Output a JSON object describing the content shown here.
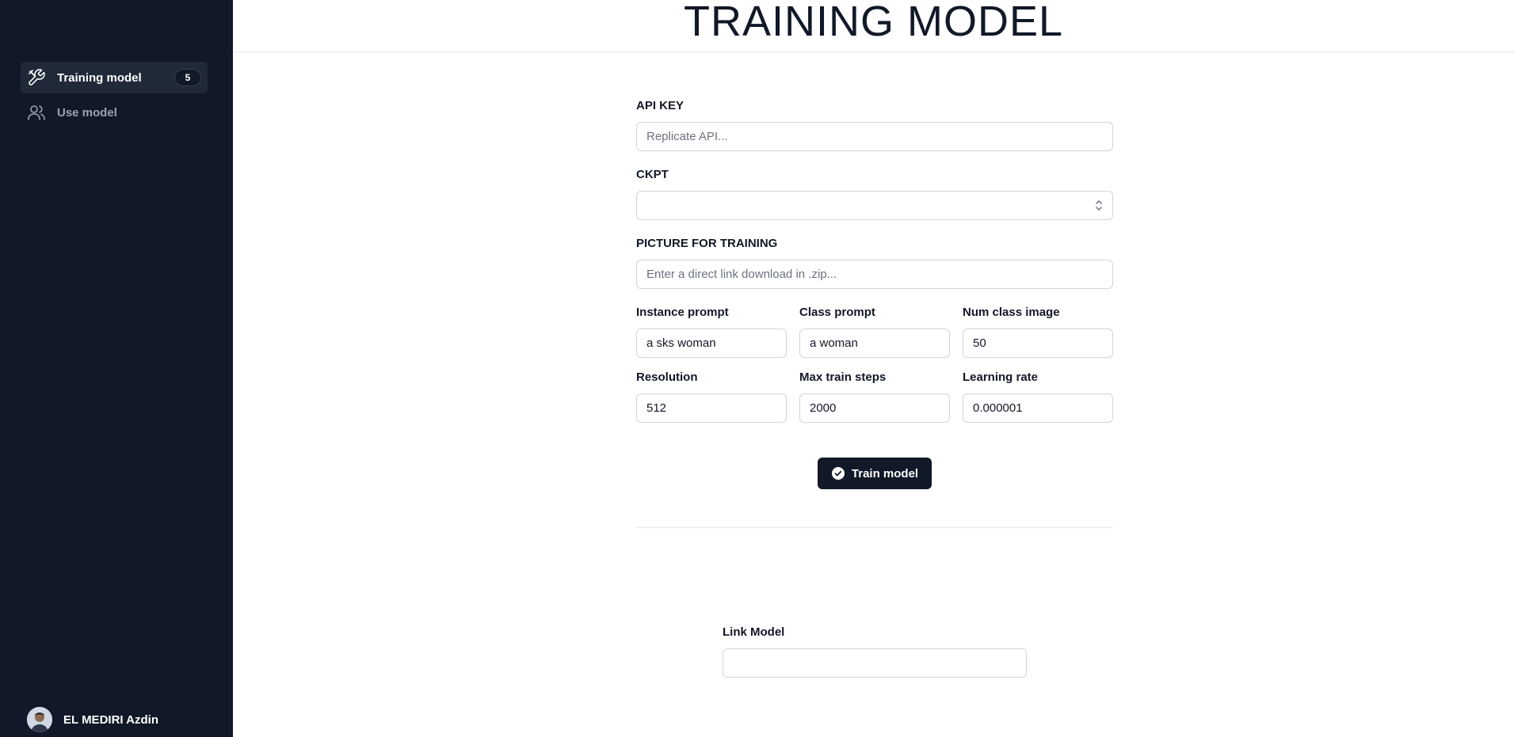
{
  "sidebar": {
    "items": [
      {
        "label": "Training model",
        "icon": "tools-icon",
        "badge": "5",
        "active": true
      },
      {
        "label": "Use model",
        "icon": "users-icon",
        "active": false
      }
    ],
    "user": {
      "name": "EL MEDIRI Azdin"
    }
  },
  "header": {
    "title": "TRAINING MODEL"
  },
  "form": {
    "api_key": {
      "label": "API KEY",
      "placeholder": "Replicate API...",
      "value": ""
    },
    "ckpt": {
      "label": "CKPT",
      "value": ""
    },
    "picture": {
      "label": "PICTURE FOR TRAINING",
      "placeholder": "Enter a direct link download in .zip...",
      "value": ""
    },
    "instance_prompt": {
      "label": "Instance prompt",
      "value": "a sks woman"
    },
    "class_prompt": {
      "label": "Class prompt",
      "value": "a woman"
    },
    "num_class_image": {
      "label": "Num class image",
      "value": "50"
    },
    "resolution": {
      "label": "Resolution",
      "value": "512"
    },
    "max_train_steps": {
      "label": "Max train steps",
      "value": "2000"
    },
    "learning_rate": {
      "label": "Learning rate",
      "value": "0.000001"
    },
    "train_button": "Train model",
    "link_model": {
      "label": "Link Model",
      "value": ""
    }
  },
  "colors": {
    "sidebar_bg": "#111827",
    "button_bg": "#111827",
    "border": "#d1d5db"
  }
}
